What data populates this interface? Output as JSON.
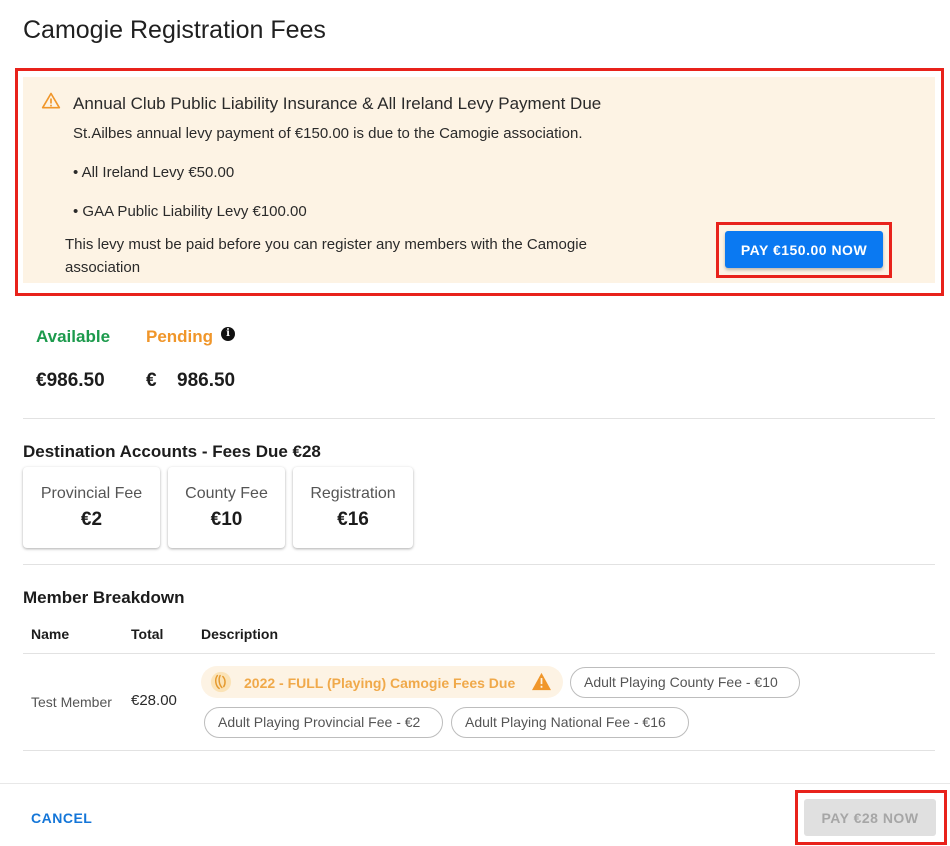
{
  "dialog": {
    "title": "Camogie Registration Fees"
  },
  "alert": {
    "icon": "warning-icon",
    "title": "Annual Club Public Liability Insurance & All Ireland Levy Payment Due",
    "text": "St.Ailbes annual levy payment of €150.00 is due to the Camogie association.",
    "levies": [
      "• All Ireland Levy €50.00",
      "• GAA Public Liability Levy €100.00"
    ],
    "note": "This levy must be paid before you can register any members with the Camogie association",
    "pay_label": "PAY €150.00 NOW"
  },
  "balances": {
    "available_label": "Available",
    "available_value": "€986.50",
    "pending_label": "Pending",
    "pending_info_icon": "info-icon",
    "pending_currency": "€",
    "pending_value": "986.50"
  },
  "destination": {
    "title": "Destination Accounts - Fees Due €28",
    "cards": [
      {
        "label": "Provincial Fee",
        "value": "€2"
      },
      {
        "label": "County Fee",
        "value": "€10"
      },
      {
        "label": "Registration",
        "value": "€16"
      }
    ]
  },
  "breakdown": {
    "title": "Member Breakdown",
    "columns": [
      "Name",
      "Total",
      "Description"
    ],
    "rows": [
      {
        "name": "Test Member",
        "total": "€28.00",
        "main_chip": "2022 - FULL (Playing) Camogie Fees Due",
        "chips": [
          "Adult Playing County Fee - €10",
          "Adult Playing Provincial Fee - €2",
          "Adult Playing National Fee - €16"
        ]
      }
    ]
  },
  "footer": {
    "cancel_label": "CANCEL",
    "pay_label": "PAY €28 NOW"
  },
  "colors": {
    "accent": "#0a79f2",
    "available": "#1c9a4c",
    "pending": "#f0962a",
    "alert_bg": "#fdf3e4",
    "highlight": "#e8221b"
  }
}
